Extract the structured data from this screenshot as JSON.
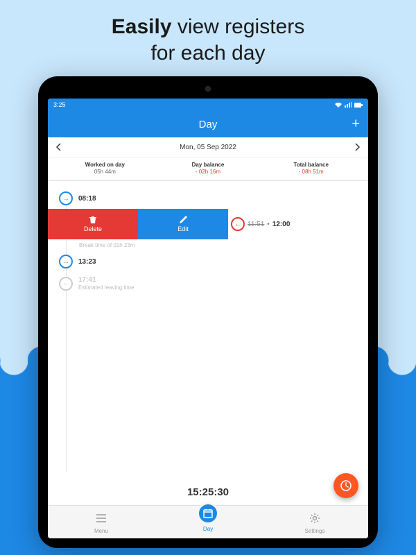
{
  "marketing": {
    "line1_bold": "Easily",
    "line1_rest": " view registers",
    "line2": "for each day"
  },
  "status": {
    "time": "3:25"
  },
  "appbar": {
    "title": "Day",
    "add": "+"
  },
  "datenav": {
    "label": "Mon, 05 Sep 2022"
  },
  "summary": {
    "worked_label": "Worked on day",
    "worked_value": "05h 44m",
    "balance_label": "Day balance",
    "balance_value": "- 02h 16m",
    "total_label": "Total balance",
    "total_value": "- 08h 51m"
  },
  "entries": {
    "e1_time": "08:18",
    "swipe_delete": "Delete",
    "swipe_edit": "Edit",
    "e2_old": "11:51",
    "e2_new": "12:00",
    "break_note": "Break time of 01h 23m",
    "e3_time": "13:23",
    "e4_time": "17:41",
    "e4_sub": "Estimated leaving time"
  },
  "clock": "15:25:30",
  "nav": {
    "menu": "Menu",
    "day": "Day",
    "settings": "Settings"
  }
}
